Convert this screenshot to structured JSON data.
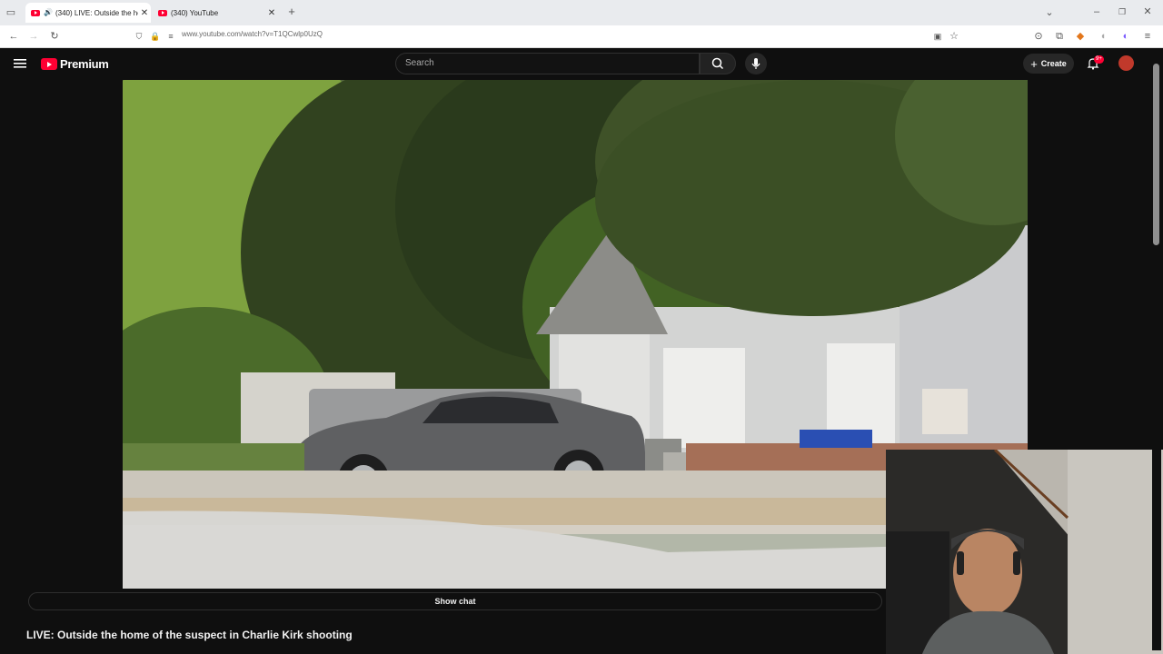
{
  "browser": {
    "tabs": [
      {
        "title": "(340) LIVE: Outside the hor",
        "active": true
      },
      {
        "title": "(340) YouTube",
        "active": false
      }
    ],
    "new_tab_symbol": "+",
    "url": "www.youtube.com/watch?v=T1QCwlp0UzQ"
  },
  "masthead": {
    "logo_text": "Premium",
    "search_placeholder": "Search",
    "create_label": "Create",
    "notification_badge": "9+"
  },
  "player": {
    "show_chat_label": "Show chat"
  },
  "video": {
    "title": "LIVE: Outside the home of the suspect in Charlie Kirk shooting"
  },
  "colors": {
    "brand_red": "#ff0033",
    "background": "#0f0f0f"
  }
}
